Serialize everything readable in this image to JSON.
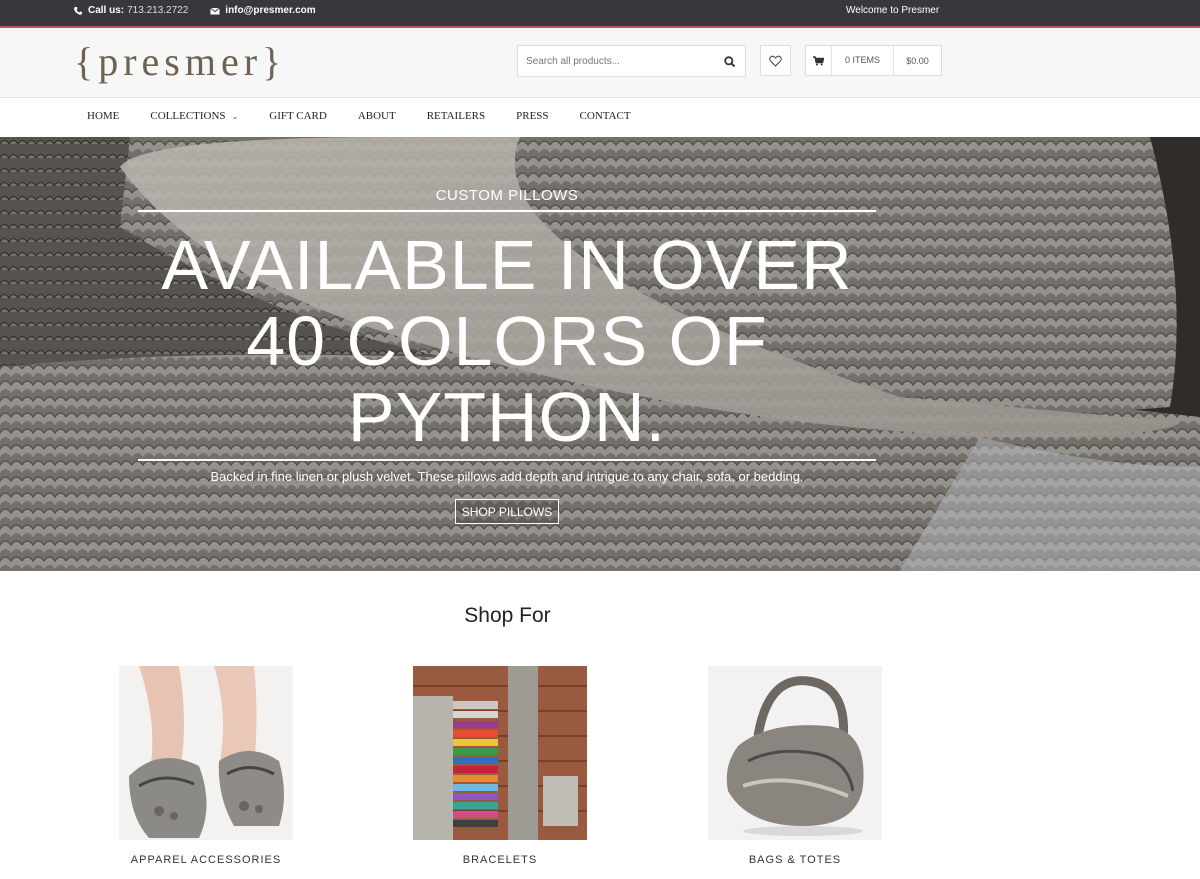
{
  "topbar": {
    "phone_label": "Call us:",
    "phone": "713.213.2722",
    "email": "info@presmer.com",
    "welcome": "Welcome to Presmer"
  },
  "header": {
    "logo": "{presmer}",
    "search_placeholder": "Search all products...",
    "cart_items": "0 ITEMS",
    "cart_total": "$0.00"
  },
  "nav": {
    "items": [
      "HOME",
      "COLLECTIONS",
      "GIFT CARD",
      "ABOUT",
      "RETAILERS",
      "PRESS",
      "CONTACT"
    ]
  },
  "hero": {
    "kicker": "CUSTOM PILLOWS",
    "headline_lines": [
      "AVAILABLE IN OVER",
      "40 COLORS OF",
      "PYTHON."
    ],
    "subtext": "Backed in fine linen or plush velvet. These pillows add depth and intrigue to any chair, sofa, or bedding.",
    "cta": "SHOP PILLOWS"
  },
  "shop": {
    "heading": "Shop For",
    "categories": [
      {
        "label": "APPAREL ACCESSORIES",
        "image": "python-sandals-photo"
      },
      {
        "label": "BRACELETS",
        "image": "python-bracelets-photo"
      },
      {
        "label": "BAGS & TOTES",
        "image": "python-bag-photo"
      }
    ]
  },
  "colors": {
    "topbar_bg": "#38383c",
    "topbar_accent": "#c0546a",
    "header_bg": "#f7f7f7",
    "logo": "#6e6353"
  }
}
